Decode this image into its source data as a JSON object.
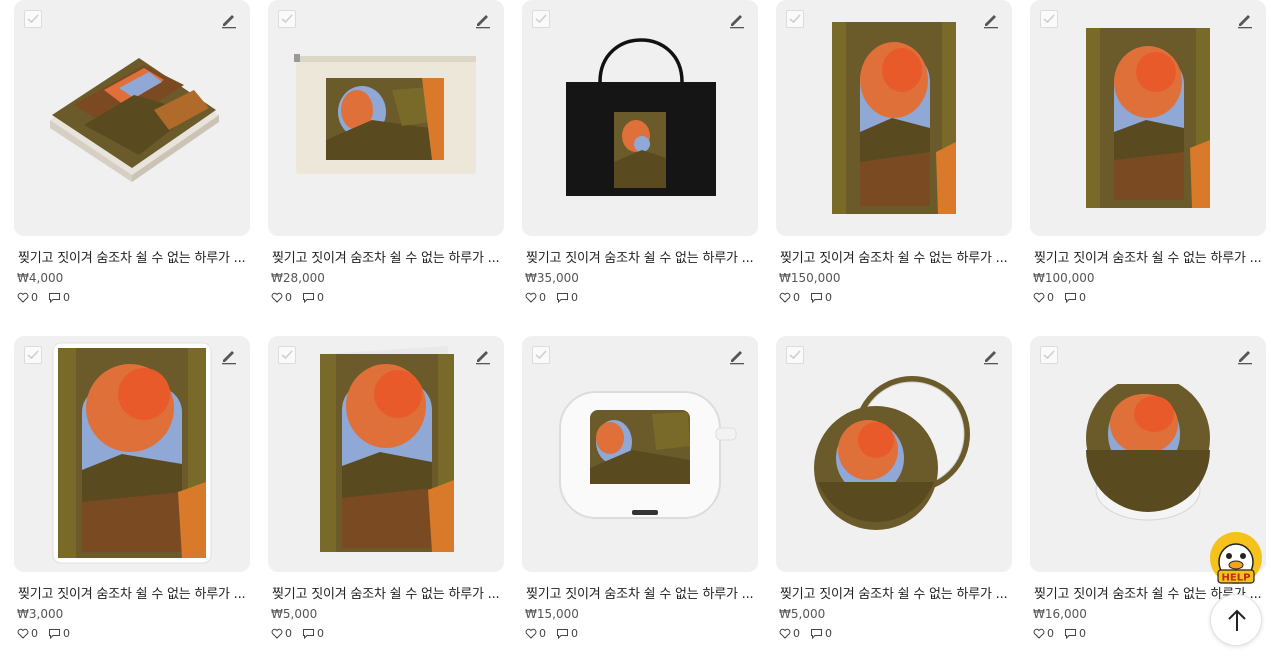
{
  "products": [
    {
      "title": "찢기고 짓이겨 숨조차 쉴 수 없는 하루가 ...",
      "price": "₩4,000",
      "likes": "0",
      "comments": "0",
      "image": "coaster-stack"
    },
    {
      "title": "찢기고 짓이겨 숨조차 쉴 수 없는 하루가 ...",
      "price": "₩28,000",
      "likes": "0",
      "comments": "0",
      "image": "canvas-pouch"
    },
    {
      "title": "찢기고 짓이겨 숨조차 쉴 수 없는 하루가 ...",
      "price": "₩35,000",
      "likes": "0",
      "comments": "0",
      "image": "black-tote-bag"
    },
    {
      "title": "찢기고 짓이겨 숨조차 쉴 수 없는 하루가 ...",
      "price": "₩150,000",
      "likes": "0",
      "comments": "0",
      "image": "poster-large"
    },
    {
      "title": "찢기고 짓이겨 숨조차 쉴 수 없는 하루가 ...",
      "price": "₩100,000",
      "likes": "0",
      "comments": "0",
      "image": "poster-medium"
    },
    {
      "title": "찢기고 짓이겨 숨조차 쉴 수 없는 하루가 ...",
      "price": "₩3,000",
      "likes": "0",
      "comments": "0",
      "image": "sticker"
    },
    {
      "title": "찢기고 짓이겨 숨조차 쉴 수 없는 하루가 ...",
      "price": "₩5,000",
      "likes": "0",
      "comments": "0",
      "image": "greeting-card"
    },
    {
      "title": "찢기고 짓이겨 숨조차 쉴 수 없는 하루가 ...",
      "price": "₩15,000",
      "likes": "0",
      "comments": "0",
      "image": "airpods-case"
    },
    {
      "title": "찢기고 짓이겨 숨조차 쉴 수 없는 하루가 ...",
      "price": "₩5,000",
      "likes": "0",
      "comments": "0",
      "image": "pocket-mirror"
    },
    {
      "title": "찢기고 짓이겨 숨조차 쉴 수 없는 하루가 ...",
      "price": "₩16,000",
      "likes": "0",
      "comments": "0",
      "image": "phone-grip"
    }
  ],
  "help_button": {
    "label": "HELP"
  },
  "colors": {
    "thumb_bg": "#f0f0f0",
    "art_green": "#6b6a2e",
    "art_orange": "#d9652a",
    "art_blue": "#8fa8d6"
  }
}
